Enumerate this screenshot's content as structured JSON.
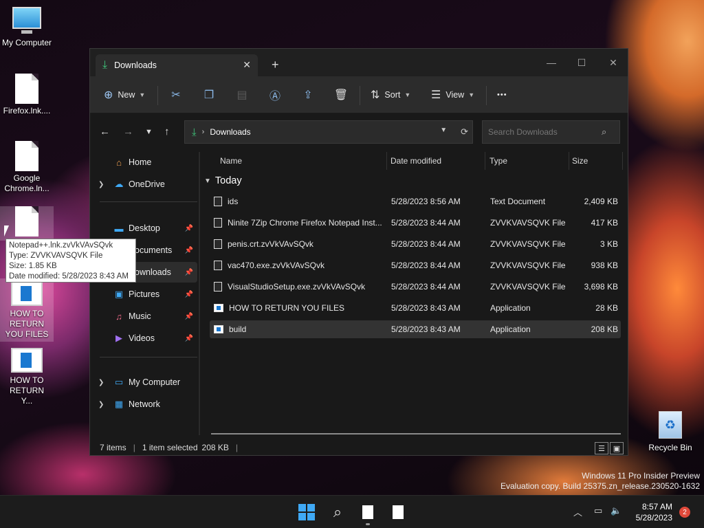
{
  "desktop": {
    "icons": [
      {
        "label": "My Computer"
      },
      {
        "label": "Firefox.lnk...."
      },
      {
        "label": "Google Chrome.ln..."
      },
      {
        "label": ""
      },
      {
        "label": "HOW TO RETURN YOU FILES"
      },
      {
        "label": "HOW TO RETURN Y..."
      }
    ],
    "recycle_bin": "Recycle Bin",
    "watermark": {
      "line1": "Windows 11 Pro Insider Preview",
      "line2": "Evaluation copy. Build 25375.zn_release.230520-1632"
    }
  },
  "tooltip": {
    "line1": "Notepad++.lnk.zvVkVAvSQvk",
    "line2": "Type: ZVVKVAVSQVK File",
    "line3": "Size: 1.85 KB",
    "line4": "Date modified: 5/28/2023 8:43 AM"
  },
  "window": {
    "tab_title": "Downloads",
    "close_tab": "✕",
    "new_tab": "+",
    "controls": {
      "minimize": "—",
      "maximize": "☐",
      "close": "✕"
    },
    "toolbar": {
      "new_label": "New",
      "sort_label": "Sort",
      "view_label": "View",
      "more_label": "•••"
    },
    "address": {
      "current": "Downloads"
    },
    "search": {
      "placeholder": "Search Downloads"
    },
    "nav_pane": {
      "items": [
        {
          "label": "Home"
        },
        {
          "label": "OneDrive"
        },
        {
          "label": "Desktop"
        },
        {
          "label": "Documents"
        },
        {
          "label": "Downloads"
        },
        {
          "label": "Pictures"
        },
        {
          "label": "Music"
        },
        {
          "label": "Videos"
        },
        {
          "label": "My Computer"
        },
        {
          "label": "Network"
        }
      ]
    },
    "columns": {
      "name": "Name",
      "date": "Date modified",
      "type": "Type",
      "size": "Size"
    },
    "group_label": "Today",
    "files": [
      {
        "name": "ids",
        "date": "5/28/2023 8:56 AM",
        "type": "Text Document",
        "size": "2,409 KB"
      },
      {
        "name": "Ninite 7Zip Chrome Firefox Notepad Inst...",
        "date": "5/28/2023 8:44 AM",
        "type": "ZVVKVAVSQVK File",
        "size": "417 KB"
      },
      {
        "name": "penis.crt.zvVkVAvSQvk",
        "date": "5/28/2023 8:44 AM",
        "type": "ZVVKVAVSQVK File",
        "size": "3 KB"
      },
      {
        "name": "vac470.exe.zvVkVAvSQvk",
        "date": "5/28/2023 8:44 AM",
        "type": "ZVVKVAVSQVK File",
        "size": "938 KB"
      },
      {
        "name": "VisualStudioSetup.exe.zvVkVAvSQvk",
        "date": "5/28/2023 8:44 AM",
        "type": "ZVVKVAVSQVK File",
        "size": "3,698 KB"
      },
      {
        "name": "HOW TO RETURN YOU FILES",
        "date": "5/28/2023 8:43 AM",
        "type": "Application",
        "size": "28 KB"
      },
      {
        "name": "build",
        "date": "5/28/2023 8:43 AM",
        "type": "Application",
        "size": "208 KB"
      }
    ],
    "status": {
      "count": "7 items",
      "selected": "1 item selected",
      "size": "208 KB"
    }
  },
  "taskbar": {
    "time": "8:57 AM",
    "date": "5/28/2023",
    "notification_count": "2"
  },
  "colors": {
    "accent": "#3fa9f5",
    "window_bg": "#191919",
    "toolbar_bg": "#2c2c2c",
    "badge": "#e0493a"
  }
}
